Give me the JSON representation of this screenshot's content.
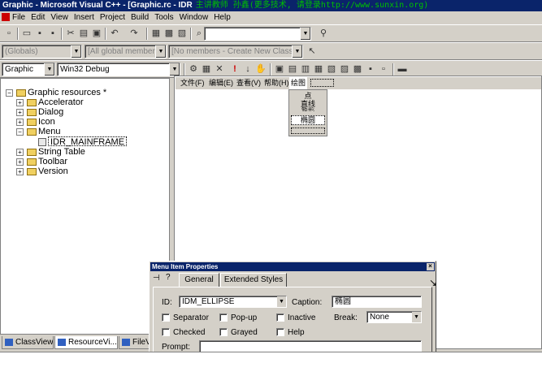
{
  "window": {
    "title": "Graphic - Microsoft Visual C++ - [Graphic.rc - IDR",
    "banner": "主讲教师 孙鑫(更多技术, 请登录http://www.sunxin.org)"
  },
  "menubar": [
    "File",
    "Edit",
    "View",
    "Insert",
    "Project",
    "Build",
    "Tools",
    "Window",
    "Help"
  ],
  "toolbar": {
    "find_combo": "",
    "class_combo": "(Globals)",
    "members_combo": "[All global members",
    "function_combo": "[No members - Create New Class...]",
    "project_combo": "Graphic",
    "config_combo": "Win32 Debug"
  },
  "tree": {
    "root": "Graphic resources *",
    "items": [
      "Accelerator",
      "Dialog",
      "Icon",
      "Menu",
      "IDR_MAINFRAME",
      "String Table",
      "Toolbar",
      "Version"
    ]
  },
  "bottom_tabs": [
    "ClassView",
    "ResourceVi...",
    "FileVi"
  ],
  "resource_menu": {
    "bar": [
      "文件(F)",
      "编辑(E)",
      "查看(V)",
      "帮助(H)",
      "绘图"
    ],
    "dropdown": [
      "点",
      "直线",
      "矩形",
      "椭圆"
    ]
  },
  "dialog": {
    "title": "Menu Item Properties",
    "tabs": [
      "General",
      "Extended Styles"
    ],
    "id_label": "ID:",
    "id_value": "IDM_ELLIPSE",
    "caption_label": "Caption:",
    "caption_value": "椭圆",
    "checkboxes": [
      "Separator",
      "Pop-up",
      "Inactive",
      "Checked",
      "Grayed",
      "Help"
    ],
    "break_label": "Break:",
    "break_value": "None",
    "prompt_label": "Prompt:",
    "prompt_value": ""
  }
}
